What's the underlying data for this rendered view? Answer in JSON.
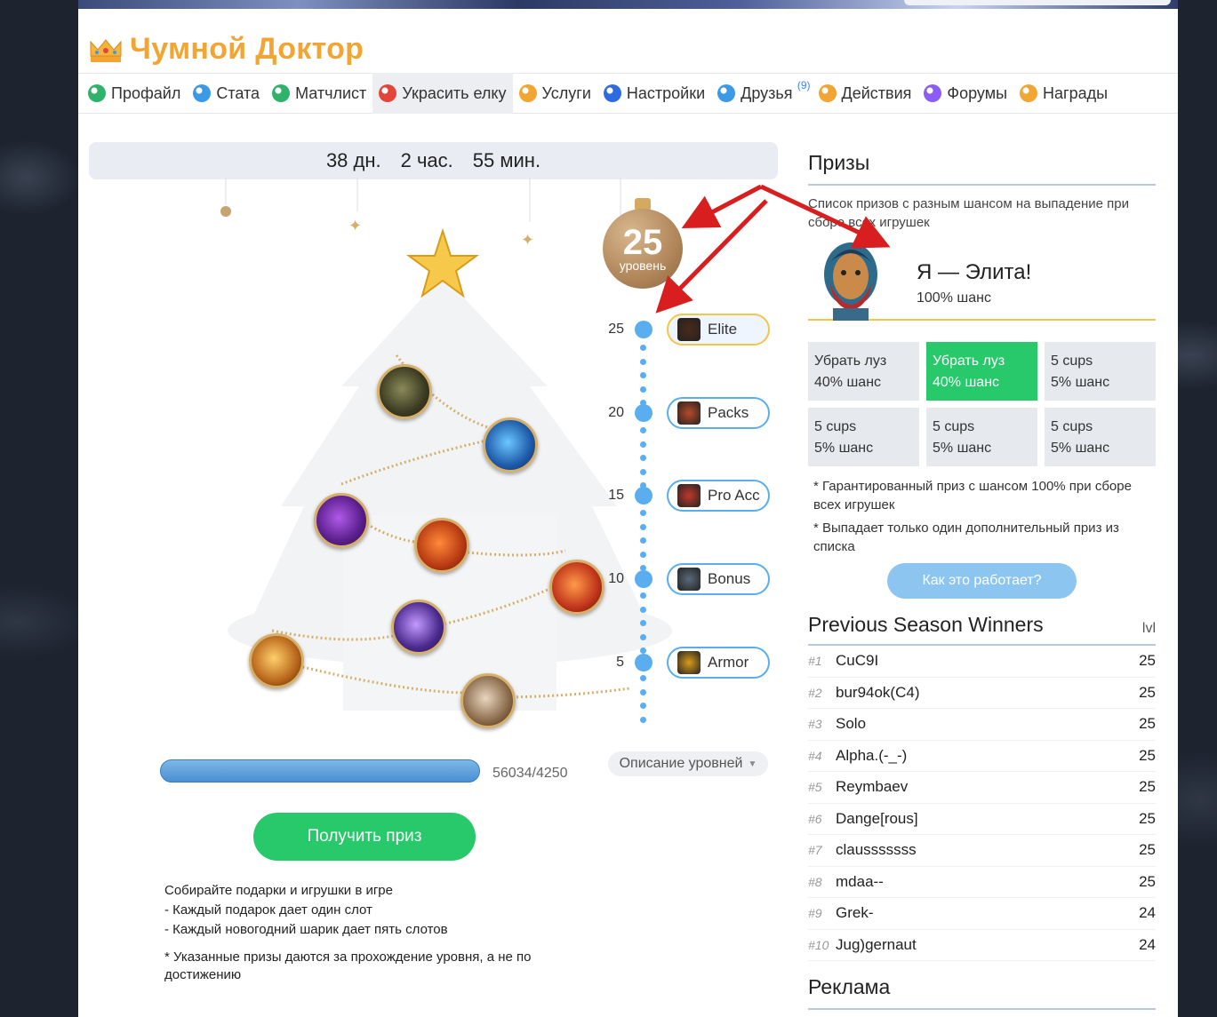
{
  "header": {
    "title": "Чумной Доктор",
    "icon": "crown-icon"
  },
  "nav": {
    "items": [
      {
        "label": "Профайл",
        "icon": "profile-icon",
        "color": "#2fb36b"
      },
      {
        "label": "Стата",
        "icon": "info-icon",
        "color": "#3b9ae8"
      },
      {
        "label": "Матчлист",
        "icon": "matchlist-icon",
        "color": "#2fb36b"
      },
      {
        "label": "Украсить елку",
        "icon": "candy-icon",
        "color": "#e2463b",
        "active": true
      },
      {
        "label": "Услуги",
        "icon": "services-icon",
        "color": "#f2a532"
      },
      {
        "label": "Настройки",
        "icon": "settings-icon",
        "color": "#2f6be0"
      },
      {
        "label": "Друзья",
        "icon": "friends-icon",
        "color": "#3b9ae8",
        "badge": "(9)"
      },
      {
        "label": "Действия",
        "icon": "actions-icon",
        "color": "#f2a532"
      },
      {
        "label": "Форумы",
        "icon": "forums-icon",
        "color": "#8b5cf6"
      },
      {
        "label": "Награды",
        "icon": "awards-icon",
        "color": "#f2a532"
      }
    ]
  },
  "timer": {
    "days": "38 дн.",
    "hours": "2 час.",
    "minutes": "55 мин."
  },
  "level": {
    "current": "25",
    "label": "уровень"
  },
  "levels": [
    {
      "num": "25",
      "name": "Elite",
      "icon": "elite-portrait-icon"
    },
    {
      "num": "20",
      "name": "Packs",
      "icon": "helmet-icon"
    },
    {
      "num": "15",
      "name": "Pro Acc",
      "icon": "chest-icon"
    },
    {
      "num": "10",
      "name": "Bonus",
      "icon": "axe-icon"
    },
    {
      "num": "5",
      "name": "Armor",
      "icon": "armor-icon"
    }
  ],
  "levels_description": "Описание уровней",
  "progress": {
    "text": "56034/4250",
    "fraction": 1.0
  },
  "get_prize": "Получить приз",
  "info": {
    "line1": "Собирайте подарки и игрушки в игре",
    "line2": "- Каждый подарок дает один слот",
    "line3": "- Каждый новогодний шарик дает пять слотов",
    "note": "* Указанные призы даются за прохождение уровня, а не по достижению"
  },
  "prizes": {
    "title": "Призы",
    "subtitle": "Список призов с разным шансом на выпадение при сборе всех игрушек",
    "main": {
      "name": "Я — Элита!",
      "chance": "100% шанс",
      "icon": "elite-portrait-icon"
    },
    "grid": [
      {
        "name": "Убрать луз",
        "chance": "40% шанс",
        "won": false
      },
      {
        "name": "Убрать луз",
        "chance": "40% шанс",
        "won": true
      },
      {
        "name": "5 cups",
        "chance": "5% шанс",
        "won": false
      },
      {
        "name": "5 cups",
        "chance": "5% шанс",
        "won": false
      },
      {
        "name": "5 cups",
        "chance": "5% шанс",
        "won": false
      },
      {
        "name": "5 cups",
        "chance": "5% шанс",
        "won": false
      }
    ],
    "note1": "* Гарантированный приз с шансом 100% при сборе всех игрушек",
    "note2": "* Выпадает только один дополнительный приз из списка",
    "how_button": "Как это работает?"
  },
  "winners": {
    "title": "Previous Season Winners",
    "lvl_header": "lvl",
    "rows": [
      {
        "rank": "#1",
        "name": "CuC9I",
        "lvl": "25"
      },
      {
        "rank": "#2",
        "name": "bur94ok(C4)",
        "lvl": "25"
      },
      {
        "rank": "#3",
        "name": "Solo",
        "lvl": "25"
      },
      {
        "rank": "#4",
        "name": "Alpha.(-_-)",
        "lvl": "25"
      },
      {
        "rank": "#5",
        "name": "Reymbaev",
        "lvl": "25"
      },
      {
        "rank": "#6",
        "name": "Dange[rous]",
        "lvl": "25"
      },
      {
        "rank": "#7",
        "name": "clausssssss",
        "lvl": "25"
      },
      {
        "rank": "#8",
        "name": "mdaa--",
        "lvl": "25"
      },
      {
        "rank": "#9",
        "name": "Grek-",
        "lvl": "24"
      },
      {
        "rank": "#10",
        "name": "Jug)gernaut",
        "lvl": "24"
      }
    ]
  },
  "ads": {
    "title": "Реклама"
  },
  "colors": {
    "accent": "#f2a532",
    "green": "#27c96a",
    "blue": "#5aaef0",
    "arrow": "#d81e1e"
  }
}
